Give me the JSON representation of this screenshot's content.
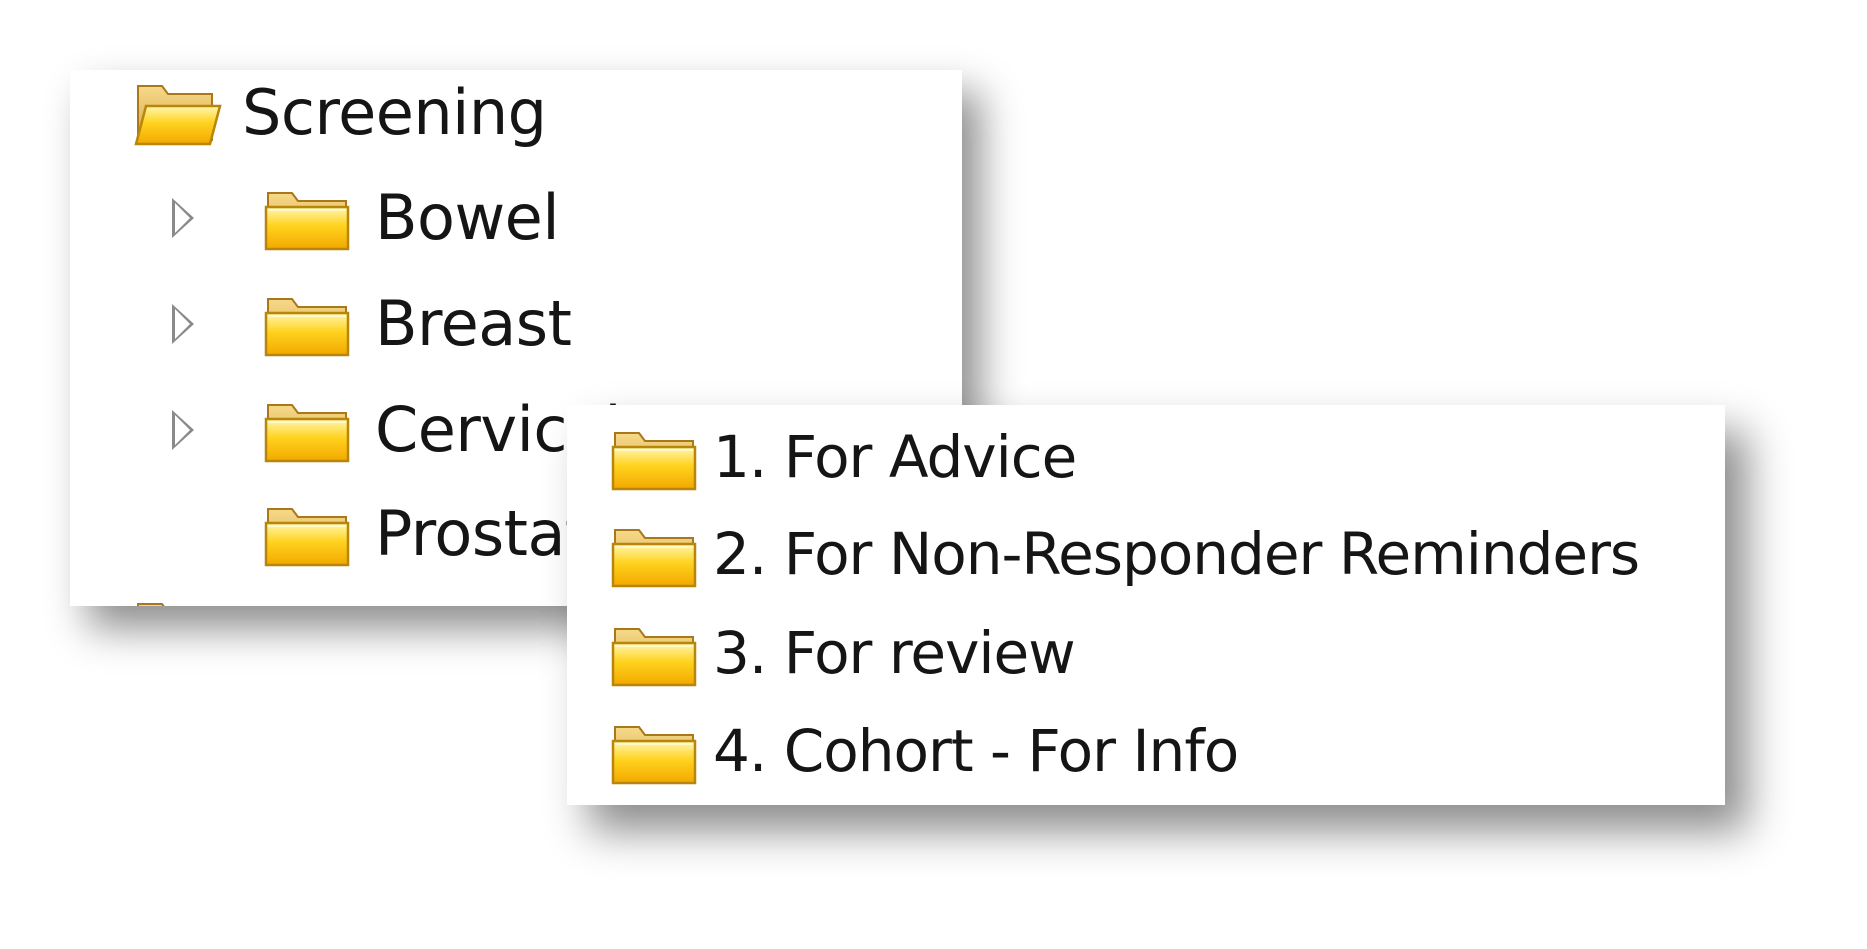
{
  "tree": {
    "root": {
      "label": "Screening",
      "icon": "open-folder-icon"
    },
    "children": [
      {
        "label": "Bowel",
        "icon": "folder-icon",
        "expandable": true
      },
      {
        "label": "Breast",
        "icon": "folder-icon",
        "expandable": true
      },
      {
        "label": "Cervical",
        "icon": "folder-icon",
        "expandable": true
      },
      {
        "label": "Prostate",
        "icon": "folder-icon",
        "expandable": false
      }
    ]
  },
  "subfolders": [
    {
      "label": "1. For Advice",
      "icon": "folder-icon"
    },
    {
      "label": "2. For Non-Responder Reminders",
      "icon": "folder-icon"
    },
    {
      "label": "3. For review",
      "icon": "folder-icon"
    },
    {
      "label": "4. Cohort - For Info",
      "icon": "folder-icon"
    }
  ],
  "colors": {
    "folder_fill": "#ffd21e",
    "folder_edge": "#b8860b",
    "expander": "#8a8a8a"
  }
}
